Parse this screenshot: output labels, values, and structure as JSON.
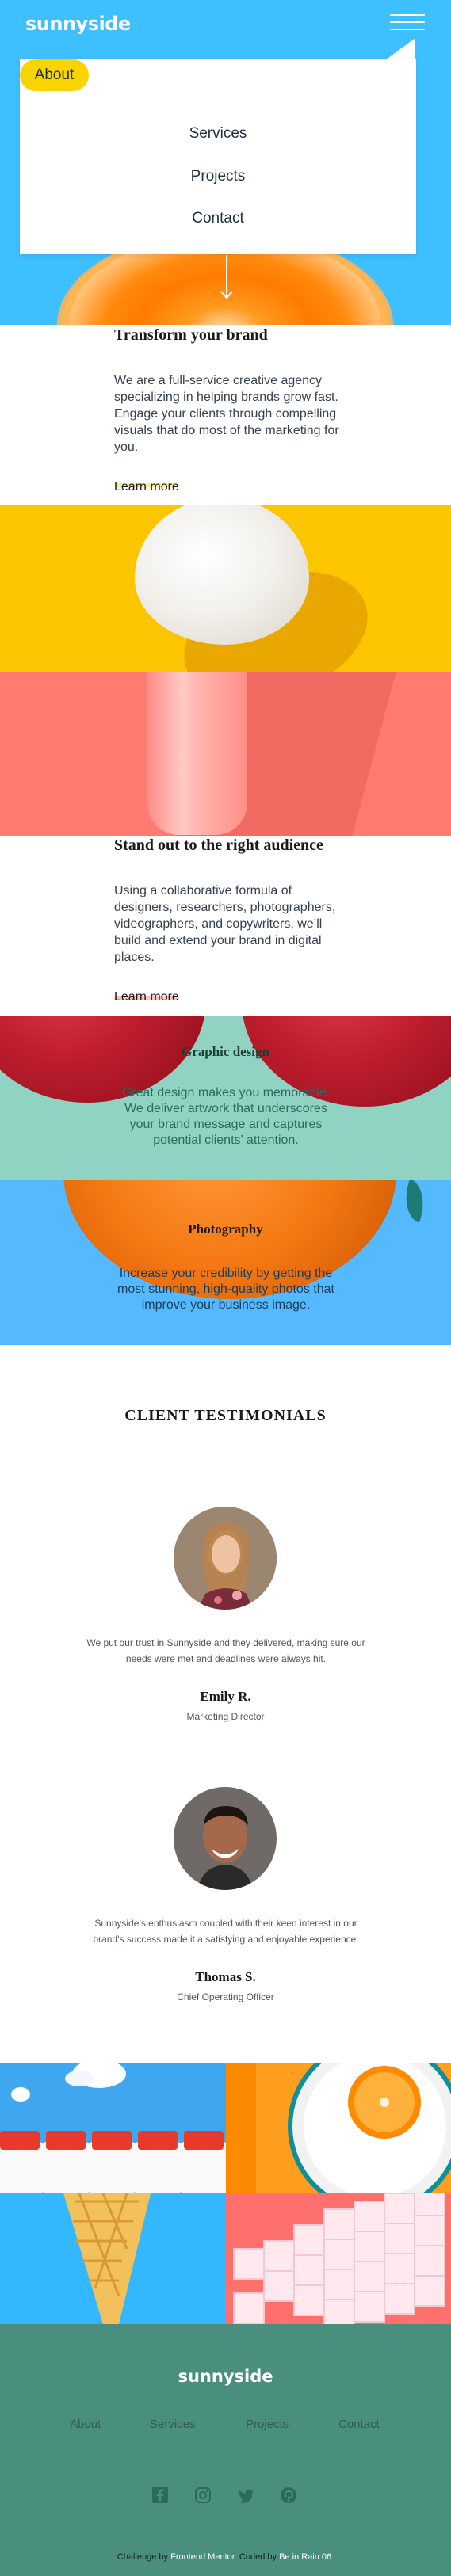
{
  "brand": {
    "logo": "sunnyside"
  },
  "nav": {
    "items": [
      {
        "label": "About",
        "active": true
      },
      {
        "label": "Services"
      },
      {
        "label": "Projects"
      },
      {
        "label": "Contact"
      }
    ]
  },
  "sections": [
    {
      "title": "Transform your brand",
      "body": "We are a full-service creative agency specializing in helping brands grow fast. Engage your clients through compelling visuals that do most of the marketing for you.",
      "link": "Learn more",
      "underline_color": "#fad400"
    },
    {
      "title": "Stand out to the right audience",
      "body": "Using a collaborative formula of designers, researchers, photographers, videographers, and copywriters, we’ll build and extend your brand in digital places.",
      "link": "Learn more",
      "underline_color": "#ff7a70"
    }
  ],
  "services": [
    {
      "title": "Graphic design",
      "body": "Great design makes you memorable. We deliver artwork that underscores your brand message and captures potential clients’ attention."
    },
    {
      "title": "Photography",
      "body": "Increase your credibility by getting the most stunning, high-quality photos that improve your business image."
    }
  ],
  "testimonials": {
    "title": "CLIENT TESTIMONIALS",
    "items": [
      {
        "quote": "We put our trust in Sunnyside and they delivered, making sure our needs were met and deadlines were always hit.",
        "name": "Emily R.",
        "role": "Marketing Director"
      },
      {
        "quote": "Sunnyside’s enthusiasm coupled with their keen interest in our brand’s success made it a satisfying and enjoyable experience.",
        "name": "Thomas S.",
        "role": "Chief Operating Officer"
      }
    ]
  },
  "footer": {
    "logo": "sunnyside",
    "links": [
      "About",
      "Services",
      "Projects",
      "Contact"
    ],
    "social_icons": [
      "facebook-icon",
      "instagram-icon",
      "twitter-icon",
      "pinterest-icon"
    ],
    "attribution": {
      "prefix": "Challenge by ",
      "challenge_link": "Frontend Mentor",
      "middle": ". Coded by ",
      "author_link": "Be in Rain 06",
      "suffix": "."
    }
  },
  "colors": {
    "hero_bg": "#3ebfff",
    "yellow": "#fad400",
    "salmon": "#ff7a70",
    "graphic_bg": "#90d3c2",
    "photo_bg": "#54b9ff",
    "footer_bg": "#4a8f7e"
  }
}
